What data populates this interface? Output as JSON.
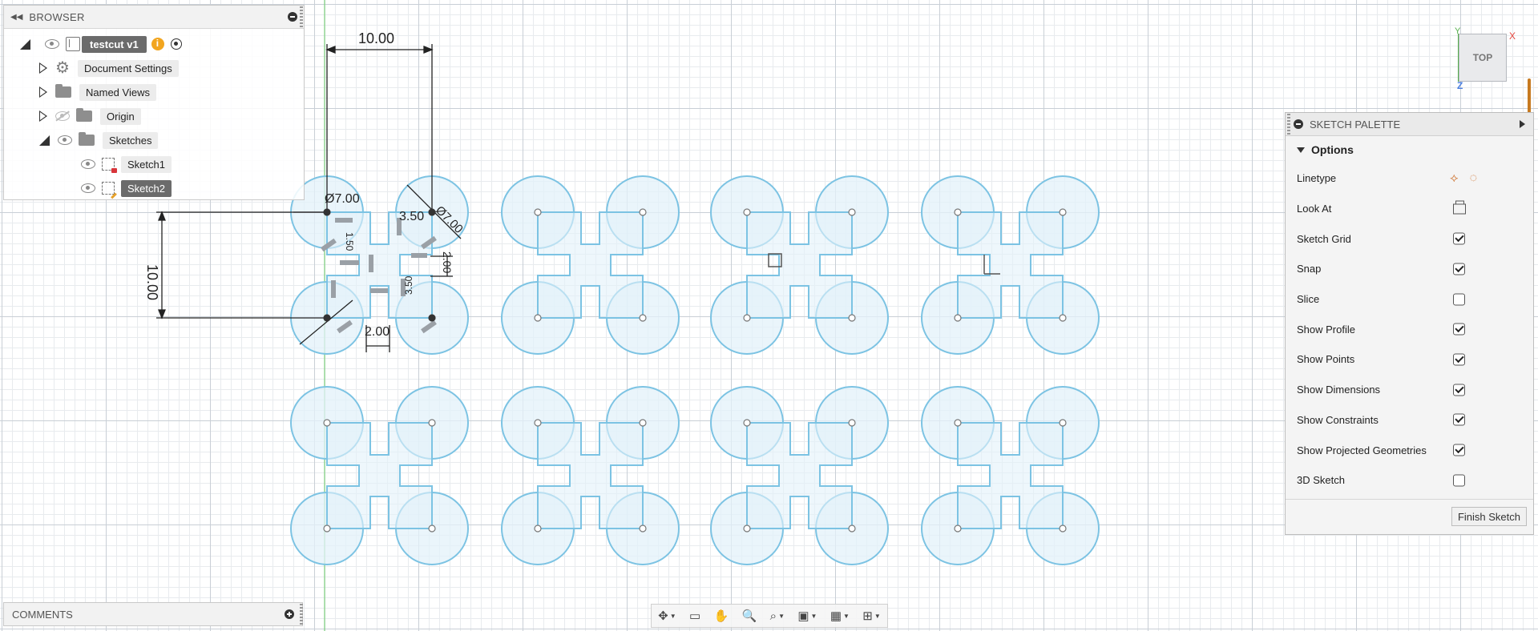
{
  "browser": {
    "title": "BROWSER",
    "document": {
      "name": "testcut v1"
    },
    "items": [
      {
        "label": "Document Settings"
      },
      {
        "label": "Named Views"
      },
      {
        "label": "Origin"
      },
      {
        "label": "Sketches"
      }
    ],
    "sketches": [
      {
        "label": "Sketch1"
      },
      {
        "label": "Sketch2"
      }
    ]
  },
  "comments": {
    "title": "COMMENTS"
  },
  "viewcube": {
    "face": "TOP",
    "axes": {
      "x": "X",
      "y": "Y",
      "z": "Z"
    }
  },
  "palette": {
    "title": "SKETCH PALETTE",
    "section": "Options",
    "options": [
      {
        "label": "Linetype",
        "control": "linetype-icons"
      },
      {
        "label": "Look At",
        "control": "look-at-icon"
      },
      {
        "label": "Sketch Grid",
        "checked": true
      },
      {
        "label": "Snap",
        "checked": true
      },
      {
        "label": "Slice",
        "checked": false
      },
      {
        "label": "Show Profile",
        "checked": true
      },
      {
        "label": "Show Points",
        "checked": true
      },
      {
        "label": "Show Dimensions",
        "checked": true
      },
      {
        "label": "Show Constraints",
        "checked": true
      },
      {
        "label": "Show Projected Geometries",
        "checked": true
      },
      {
        "label": "3D Sketch",
        "checked": false
      }
    ],
    "finish_label": "Finish Sketch"
  },
  "dimensions": {
    "width": "10.00",
    "height": "10.00",
    "dia_large": "Ø7.00",
    "dia_small": "Ø7.00",
    "offset": "3.50",
    "slot_v": "2.00",
    "slot_h": "2.00",
    "small_a": "3.50",
    "small_b": "1.50"
  },
  "colors": {
    "sketch_line": "#7cc3e3",
    "profile_fill": "#e3f1fa",
    "dimension": "#222222",
    "accent": "#c77a20"
  }
}
